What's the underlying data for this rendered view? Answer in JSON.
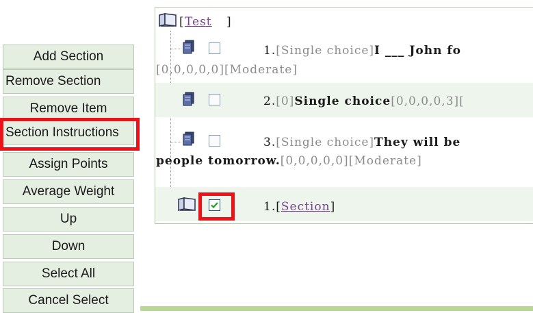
{
  "sidebar": {
    "buttons": [
      {
        "label": "Add Section"
      },
      {
        "label": "Remove Section"
      },
      {
        "label": "Remove Item"
      },
      {
        "label": "Section Instructions"
      },
      {
        "label": "Assign Points"
      },
      {
        "label": "Average Weight"
      },
      {
        "label": "Up"
      },
      {
        "label": "Down"
      },
      {
        "label": "Select All"
      },
      {
        "label": "Cancel Select"
      }
    ]
  },
  "tree": {
    "root": {
      "label": "Test",
      "bracket_open": "[",
      "bracket_close": "]"
    },
    "items": [
      {
        "num": "1.",
        "type_tag": "[Single choice]",
        "text": "I ___ John fo",
        "line2_meta": "[0,0,0,0,0][Moderate]",
        "checked": false
      },
      {
        "num": "2.",
        "type_tag": "[0]",
        "text": "Single choice",
        "meta": "[0,0,0,0,3][",
        "checked": false
      },
      {
        "num": "3.",
        "type_tag": "[Single choice]",
        "text": "They will be",
        "line2_text": "people tomorrow.",
        "line2_meta": "[0,0,0,0,0][Moderate]",
        "checked": false
      }
    ],
    "section": {
      "num": "1.",
      "label": "Section",
      "bracket_open": "[",
      "bracket_close": "]",
      "checked": true
    }
  },
  "colors": {
    "button_bg": "#e4efe2",
    "highlight": "#e8141a",
    "link": "#7a3f8f",
    "meta_gray": "#8c8c8c",
    "bar_green": "#b8d898"
  }
}
